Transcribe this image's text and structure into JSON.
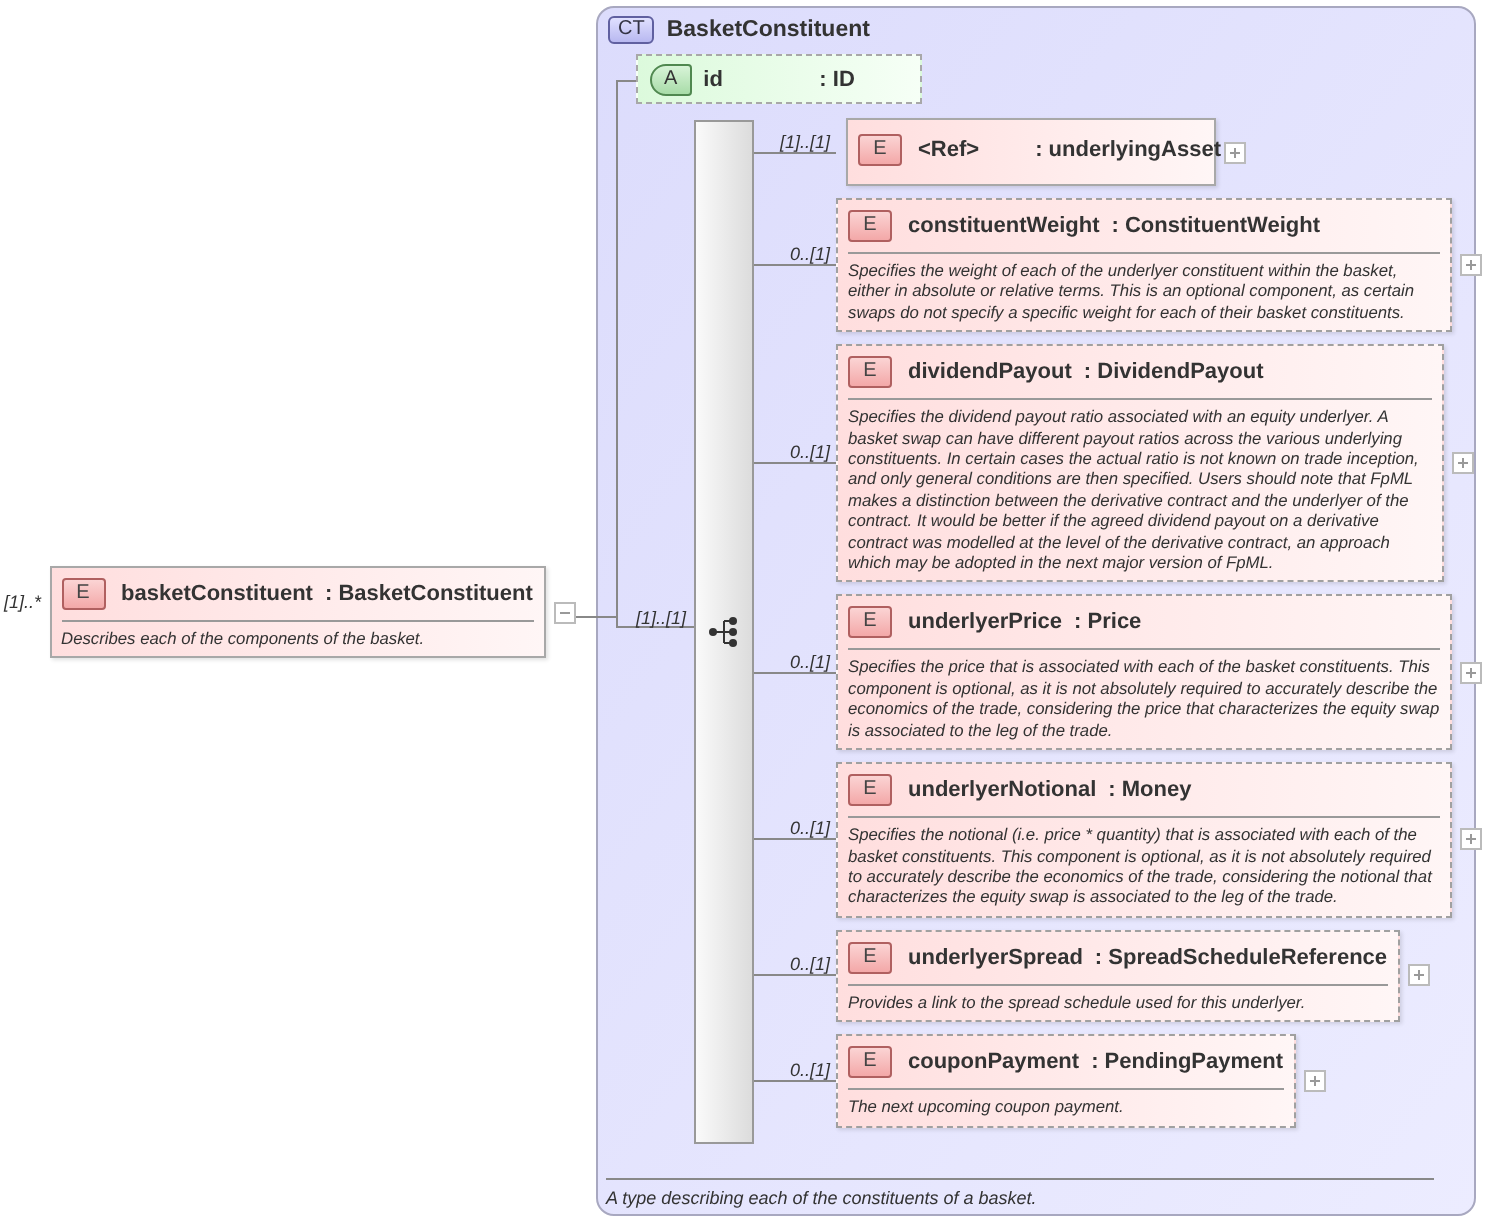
{
  "root": {
    "occurrence": "[1]..*",
    "badge": "E",
    "name": "basketConstituent",
    "type": ": BasketConstituent",
    "description": "Describes each of the components of the basket.",
    "expanded": true
  },
  "complex_type": {
    "badge": "CT",
    "title": "BasketConstituent",
    "description": "A type describing each of the constituents of a basket."
  },
  "attribute": {
    "badge": "A",
    "name": "id",
    "type": ": ID",
    "optional": true
  },
  "sequence": {
    "occurrence": "[1]..[1]"
  },
  "children": [
    {
      "occurrence": "[1]..[1]",
      "badge": "E",
      "name": "<Ref>",
      "type": ": underlyingAsset",
      "optional": false,
      "expanded": false
    },
    {
      "occurrence": "0..[1]",
      "badge": "E",
      "name": "constituentWeight",
      "type": ": ConstituentWeight",
      "description": "Specifies the weight of each of the underlyer constituent within the basket, either in absolute or relative terms. This is an optional component, as certain swaps do not specify a specific weight for each of their basket constituents.",
      "optional": true,
      "expanded": false
    },
    {
      "occurrence": "0..[1]",
      "badge": "E",
      "name": "dividendPayout",
      "type": ": DividendPayout",
      "description": "Specifies the dividend payout ratio associated with an equity underlyer. A basket swap can have different payout ratios across the various underlying constituents. In certain cases the actual ratio is not known on trade inception, and only general conditions are then specified. Users should note that FpML makes a distinction between the derivative contract and the underlyer of the contract. It would be better if the agreed dividend payout on a derivative contract was modelled at the level of the derivative contract, an approach which may be adopted in the next major version of FpML.",
      "optional": true,
      "expanded": false
    },
    {
      "occurrence": "0..[1]",
      "badge": "E",
      "name": "underlyerPrice",
      "type": ": Price",
      "description": "Specifies the price that is associated with each of the basket constituents. This component is optional, as it is not absolutely required to accurately describe the economics of the trade, considering the price that characterizes the equity swap is associated to the leg of the trade.",
      "optional": true,
      "expanded": false
    },
    {
      "occurrence": "0..[1]",
      "badge": "E",
      "name": "underlyerNotional",
      "type": ": Money",
      "description": "Specifies the notional (i.e. price * quantity) that is associated with each of the basket constituents. This component is optional, as it is not absolutely required to accurately describe the economics of the trade, considering the notional that characterizes the equity swap is associated to the leg of the trade.",
      "optional": true,
      "expanded": false
    },
    {
      "occurrence": "0..[1]",
      "badge": "E",
      "name": "underlyerSpread",
      "type": ": SpreadScheduleReference",
      "description": "Provides a link to the spread schedule used for this underlyer.",
      "optional": true,
      "expanded": false
    },
    {
      "occurrence": "0..[1]",
      "badge": "E",
      "name": "couponPayment",
      "type": ": PendingPayment",
      "description": "The next upcoming coupon payment.",
      "optional": true,
      "expanded": false
    }
  ]
}
